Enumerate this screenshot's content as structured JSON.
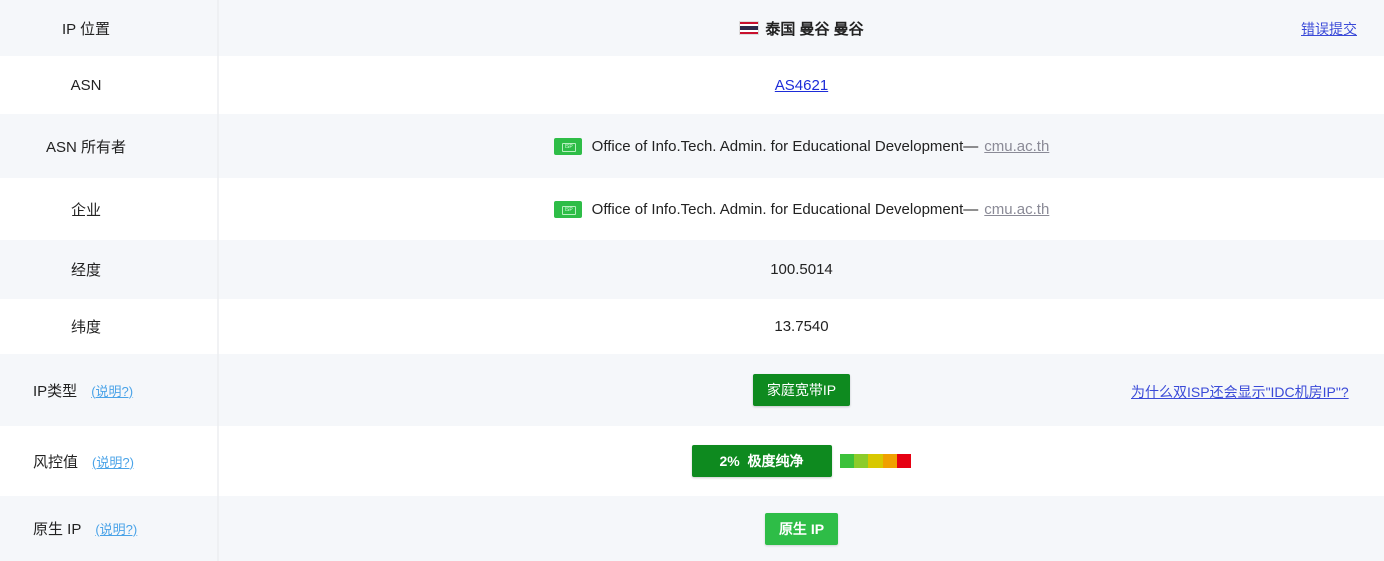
{
  "rows": {
    "ip_location": {
      "label": "IP 位置",
      "value": "泰国 曼谷 曼谷",
      "flag": "thailand-flag",
      "report_link": "错误提交"
    },
    "asn": {
      "label": "ASN",
      "value": "AS4621"
    },
    "asn_owner": {
      "label": "ASN 所有者",
      "badge_icon": "isp-badge-icon",
      "value": "Office of Info.Tech. Admin. for Educational Development—",
      "domain": "cmu.ac.th"
    },
    "company": {
      "label": "企业",
      "badge_icon": "isp-badge-icon",
      "value": "Office of Info.Tech. Admin. for Educational Development—",
      "domain": "cmu.ac.th"
    },
    "longitude": {
      "label": "经度",
      "value": "100.5014"
    },
    "latitude": {
      "label": "纬度",
      "value": "13.7540"
    },
    "ip_type": {
      "label": "IP类型",
      "help": "(说明?)",
      "badge": "家庭宽带IP",
      "side_link": "为什么双ISP还会显示\"IDC机房IP\"?"
    },
    "risk": {
      "label": "风控值",
      "help": "(说明?)",
      "badge": "2%  极度纯净",
      "scale_colors": [
        "#3cc13b",
        "#8ccc2a",
        "#d8c800",
        "#f0a000",
        "#e60012"
      ]
    },
    "native_ip": {
      "label": "原生 IP",
      "help": "(说明?)",
      "badge": "原生 IP"
    }
  },
  "colors": {
    "dark_green": "#0e8a1f",
    "light_green": "#2ebd47",
    "link_blue": "#1d2cd8",
    "help_blue": "#4aa3e8"
  }
}
